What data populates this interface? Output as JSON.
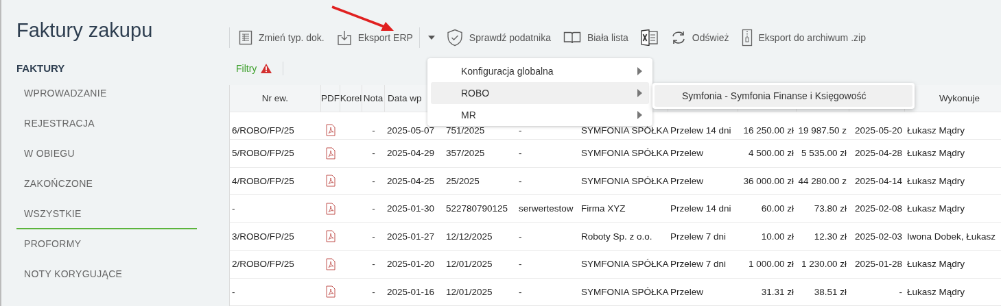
{
  "page_title": "Faktury zakupu",
  "sidebar": {
    "section": "FAKTURY",
    "items": [
      {
        "label": "WPROWADZANIE",
        "selected": false
      },
      {
        "label": "REJESTRACJA",
        "selected": false
      },
      {
        "label": "W OBIEGU",
        "selected": false
      },
      {
        "label": "ZAKOŃCZONE",
        "selected": false
      },
      {
        "label": "WSZYSTKIE",
        "selected": true
      },
      {
        "label": "PROFORMY",
        "selected": false
      },
      {
        "label": "NOTY KORYGUJĄCE",
        "selected": false
      }
    ]
  },
  "toolbar": [
    {
      "kind": "doc",
      "label": "Zmień typ. dok."
    },
    {
      "kind": "download",
      "label": "Eksport ERP"
    },
    {
      "kind": "caret"
    },
    {
      "kind": "shield",
      "label": "Sprawdź podatnika"
    },
    {
      "kind": "book",
      "label": "Biała lista"
    },
    {
      "kind": "excel"
    },
    {
      "kind": "refresh",
      "label": "Odśwież"
    },
    {
      "kind": "zip",
      "label": "Eksport do archiwum .zip"
    }
  ],
  "filters": {
    "label": "Filtry",
    "warning": true
  },
  "table": {
    "columns_left": [
      "Nr ew.",
      "PDF",
      "Korel",
      "Nota",
      "Data wp"
    ],
    "columns_right": [
      "Wykonuje"
    ],
    "rows": [
      {
        "cells": [
          "6/ROBO/FP/25",
          "-",
          "2025-05-07",
          "751/2025",
          "-",
          "SYMFONIA SPÓŁKA",
          "Przelew 14 dni",
          "16 250.00 zł",
          "19 987.50 z",
          "2025-05-20",
          "Łukasz Mądry"
        ]
      },
      {
        "cells": [
          "5/ROBO/FP/25",
          "-",
          "2025-04-29",
          "357/2025",
          "-",
          "SYMFONIA SPÓŁKA",
          "Przelew",
          "4 500.00 zł",
          "5 535.00 zł",
          "2025-04-28",
          "Łukasz Mądry"
        ]
      },
      {
        "cells": [
          "4/ROBO/FP/25",
          "-",
          "2025-04-25",
          "25/2025",
          "-",
          "SYMFONIA SPÓŁKA",
          "Przelew",
          "36 000.00 zł",
          "44 280.00 z",
          "2025-04-14",
          "Łukasz Mądry"
        ]
      },
      {
        "cells": [
          "-",
          "-",
          "2025-01-30",
          "522780790125",
          "serwertestow",
          "Firma XYZ",
          "Przelew 14 dni",
          "60.00 zł",
          "73.80 zł",
          "2025-02-08",
          "Łukasz Mądry"
        ]
      },
      {
        "cells": [
          "3/ROBO/FP/25",
          "-",
          "2025-01-27",
          "12/12/2025",
          "-",
          "Roboty Sp. z o.o.",
          "Przelew 7 dni",
          "10.00 zł",
          "12.30 zł",
          "2025-02-03",
          "Iwona Dobek, Łukasz"
        ]
      },
      {
        "cells": [
          "2/ROBO/FP/25",
          "-",
          "2025-01-20",
          "12/01/2025",
          "-",
          "SYMFONIA SPÓŁKA",
          "Przelew 7 dni",
          "1 000.00 zł",
          "1 230.00 zł",
          "2025-01-28",
          "Łukasz Mądry"
        ]
      },
      {
        "cells": [
          "-",
          "-",
          "2025-01-16",
          "12/01/2025",
          "-",
          "SYMFONIA SPÓŁKA",
          "Przelew",
          "31.31 zł",
          "38.51 zł",
          "-",
          "Łukasz Mądry"
        ]
      }
    ]
  },
  "menu": {
    "items": [
      {
        "label": "Konfiguracja globalna",
        "selected": false
      },
      {
        "label": "ROBO",
        "selected": true
      },
      {
        "label": "MR",
        "selected": false
      }
    ],
    "submenu": {
      "items": [
        {
          "label": "Symfonia - Symfonia Finanse i Księgowość",
          "selected": true
        }
      ]
    }
  }
}
